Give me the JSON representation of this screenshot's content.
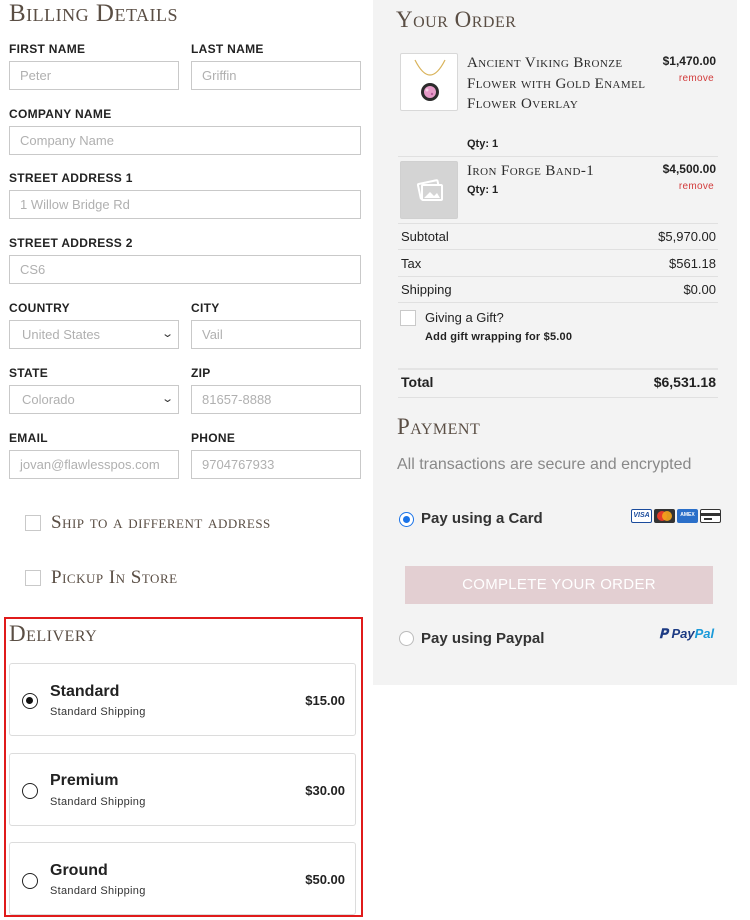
{
  "billing": {
    "title": "Billing Details",
    "first_name": {
      "label": "FIRST NAME",
      "value": "Peter"
    },
    "last_name": {
      "label": "LAST NAME",
      "value": "Griffin"
    },
    "company": {
      "label": "COMPANY NAME",
      "placeholder": "Company Name"
    },
    "street1": {
      "label": "STREET ADDRESS 1",
      "value": "1 Willow Bridge Rd"
    },
    "street2": {
      "label": "STREET ADDRESS 2",
      "value": "CS6"
    },
    "country": {
      "label": "COUNTRY",
      "value": "United States"
    },
    "city": {
      "label": "CITY",
      "value": "Vail"
    },
    "state": {
      "label": "STATE",
      "value": "Colorado"
    },
    "zip": {
      "label": "ZIP",
      "value": "81657-8888"
    },
    "email": {
      "label": "EMAIL",
      "value": "jovan@flawlesspos.com"
    },
    "phone": {
      "label": "PHONE",
      "value": "9704767933"
    },
    "ship_different": "Ship to a different address",
    "pickup": "Pickup In Store"
  },
  "delivery": {
    "title": "Delivery",
    "options": [
      {
        "name": "Standard",
        "sub": "Standard Shipping",
        "price": "$15.00",
        "selected": true
      },
      {
        "name": "Premium",
        "sub": "Standard Shipping",
        "price": "$30.00",
        "selected": false
      },
      {
        "name": "Ground",
        "sub": "Standard Shipping",
        "price": "$50.00",
        "selected": false
      }
    ]
  },
  "order": {
    "title": "Your Order",
    "items": [
      {
        "name": "Ancient Viking Bronze Flower with Gold Enamel Flower Overlay",
        "qty": "Qty: 1",
        "price": "$1,470.00",
        "remove": "remove",
        "icon": "necklace-thumbnail"
      },
      {
        "name": "Iron Forge Band-1",
        "qty": "Qty: 1",
        "price": "$4,500.00",
        "remove": "remove",
        "icon": "image-placeholder-icon"
      }
    ],
    "subtotal": {
      "label": "Subtotal",
      "value": "$5,970.00"
    },
    "tax": {
      "label": "Tax",
      "value": "$561.18"
    },
    "shipping": {
      "label": "Shipping",
      "value": "$0.00"
    },
    "gift": {
      "label": "Giving a Gift?",
      "note": "Add gift wrapping for $5.00"
    },
    "total": {
      "label": "Total",
      "value": "$6,531.18"
    }
  },
  "payment": {
    "title": "Payment",
    "subtitle": "All transactions are secure and encrypted",
    "card_label": "Pay using a Card",
    "card_selected": true,
    "cta": "COMPLETE YOUR ORDER",
    "paypal_label": "Pay using Paypal",
    "paypal_logo_a": "Pay",
    "paypal_logo_b": "Pal",
    "colors": {
      "radio_active": "#1a73e8",
      "cta_bg": "#e3cfd2",
      "highlight": "#e01b1b"
    }
  }
}
